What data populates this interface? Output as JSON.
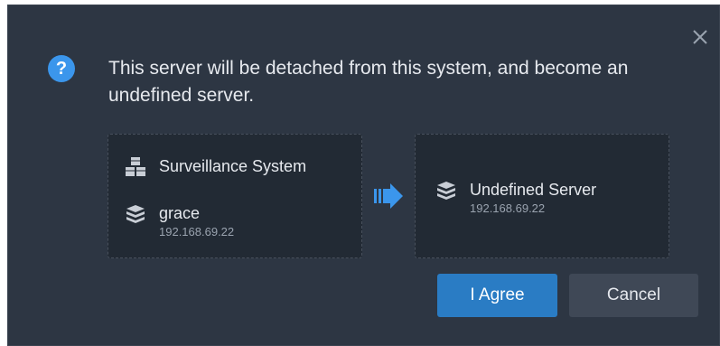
{
  "dialog": {
    "message": "This server will be detached from this system, and become an undefined server.",
    "icons": {
      "close": "close-icon",
      "question": "question-circle-icon",
      "system": "cubes-icon",
      "server": "server-stack-icon",
      "arrow": "arrow-right-icon"
    },
    "source": {
      "system_label": "Surveillance System",
      "server_name": "grace",
      "server_ip": "192.168.69.22"
    },
    "target": {
      "server_name": "Undefined Server",
      "server_ip": "192.168.69.22"
    },
    "buttons": {
      "agree": "I Agree",
      "cancel": "Cancel"
    },
    "colors": {
      "background": "#2d3643",
      "panel": "#222a34",
      "accent": "#3b96ec",
      "primary_button": "#2a7cc4",
      "secondary_button": "#3f4856"
    }
  }
}
